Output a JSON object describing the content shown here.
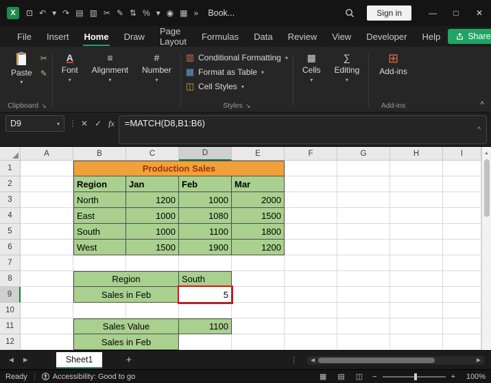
{
  "icons": {
    "chevron_down": "▾",
    "dialog_launcher": "↘",
    "collapse_ribbon": "^",
    "excel_logo": "X",
    "sheet_nav_left": "◀",
    "sheet_nav_right": "▶",
    "hscroll_left": "◀",
    "hscroll_right": "▶",
    "vscroll_up": "▴",
    "add_sheet": "+",
    "cancel": "✕",
    "enter": "✓",
    "insert_function": "fx",
    "formula_dots": "⋮",
    "zoom_out": "−",
    "zoom_in": "+"
  },
  "colors": {
    "accent_green": "#107C41",
    "share_green": "#21A366",
    "table_green": "#A9D08E",
    "title_orange": "#F1A13B",
    "title_text": "#9C3306",
    "annotation_red": "#E01010"
  },
  "titlebar": {
    "workbook_name": "Book...",
    "signin_label": "Sign in",
    "window": {
      "minimize": "—",
      "maximize": "□",
      "close": "✕"
    },
    "quick_access": [
      {
        "name": "save-icon",
        "glyph": "⊡"
      },
      {
        "name": "undo-icon",
        "glyph": "↶"
      },
      {
        "name": "undo-dropdown-icon",
        "glyph": "▾"
      },
      {
        "name": "redo-icon",
        "glyph": "↷"
      },
      {
        "name": "copy-icon",
        "glyph": "▤"
      },
      {
        "name": "paste-small-icon",
        "glyph": "▥"
      },
      {
        "name": "cut-icon",
        "glyph": "✂"
      },
      {
        "name": "format-painter-icon",
        "glyph": "✎"
      },
      {
        "name": "sort-icon",
        "glyph": "⇅"
      },
      {
        "name": "percent-style-icon",
        "glyph": "%"
      },
      {
        "name": "more-commands-icon",
        "glyph": "▾"
      },
      {
        "name": "screenshot-icon",
        "glyph": "◉"
      },
      {
        "name": "table-icon",
        "glyph": "▦"
      },
      {
        "name": "toolbar-overflow-icon",
        "glyph": "»"
      }
    ]
  },
  "menubar": {
    "tabs": [
      "File",
      "Insert",
      "Home",
      "Draw",
      "Page Layout",
      "Formulas",
      "Data",
      "Review",
      "View",
      "Developer",
      "Help"
    ],
    "active_tab": "Home",
    "share_label": "Share"
  },
  "ribbon": {
    "paste_label": "Paste",
    "clipboard_group_label": "Clipboard",
    "collapsed_left": [
      {
        "label": "Font",
        "icon": "font-icon",
        "glyph": "A",
        "cls": "font-a"
      },
      {
        "label": "Alignment",
        "icon": "alignment-icon",
        "glyph": "≡",
        "cls": ""
      },
      {
        "label": "Number",
        "icon": "number-icon",
        "glyph": "#",
        "cls": ""
      }
    ],
    "styles_items": [
      {
        "label": "Conditional Formatting",
        "icon": "conditional-formatting-icon",
        "glyph": "▥",
        "color": "#D9664C"
      },
      {
        "label": "Format as Table",
        "icon": "format-as-table-icon",
        "glyph": "▦",
        "color": "#6B9BD2"
      },
      {
        "label": "Cell Styles",
        "icon": "cell-styles-icon",
        "glyph": "◫",
        "color": "#D8A13E"
      }
    ],
    "styles_group_label": "Styles",
    "collapsed_right": [
      {
        "label": "Cells",
        "icon": "cells-icon",
        "glyph": "▦",
        "cls": ""
      },
      {
        "label": "Editing",
        "icon": "editing-icon",
        "glyph": "∑",
        "cls": ""
      }
    ],
    "addins_label": "Add-ins",
    "addins_group_label": "Add-ins"
  },
  "formula_bar": {
    "name_box": "D9",
    "formula": "=MATCH(D8,B1:B6)"
  },
  "grid": {
    "column_letters": [
      "A",
      "B",
      "C",
      "D",
      "E",
      "F",
      "G",
      "H",
      "I"
    ],
    "row_count": 12,
    "active_cell": "D9",
    "selected_column": "D",
    "selected_row": 9,
    "cells": [
      {
        "ref": "B1",
        "text": "Production Sales",
        "colspan": 4,
        "cls": "c-title tbl tbl-t tbl-l"
      },
      {
        "ref": "B2",
        "text": "Region",
        "cls": "c-green c-bold c-left tbl tbl-l"
      },
      {
        "ref": "C2",
        "text": "Jan",
        "cls": "c-green c-bold c-left tbl"
      },
      {
        "ref": "D2",
        "text": "Feb",
        "cls": "c-green c-bold c-left tbl"
      },
      {
        "ref": "E2",
        "text": "Mar",
        "cls": "c-green c-bold c-left tbl"
      },
      {
        "ref": "B3",
        "text": "North",
        "cls": "c-green c-left tbl tbl-l"
      },
      {
        "ref": "C3",
        "text": "1200",
        "cls": "c-green c-num tbl"
      },
      {
        "ref": "D3",
        "text": "1000",
        "cls": "c-green c-num tbl"
      },
      {
        "ref": "E3",
        "text": "2000",
        "cls": "c-green c-num tbl"
      },
      {
        "ref": "B4",
        "text": "East",
        "cls": "c-green c-left tbl tbl-l"
      },
      {
        "ref": "C4",
        "text": "1000",
        "cls": "c-green c-num tbl"
      },
      {
        "ref": "D4",
        "text": "1080",
        "cls": "c-green c-num tbl"
      },
      {
        "ref": "E4",
        "text": "1500",
        "cls": "c-green c-num tbl"
      },
      {
        "ref": "B5",
        "text": "South",
        "cls": "c-green c-left tbl tbl-l"
      },
      {
        "ref": "C5",
        "text": "1000",
        "cls": "c-green c-num tbl"
      },
      {
        "ref": "D5",
        "text": "1100",
        "cls": "c-green c-num tbl"
      },
      {
        "ref": "E5",
        "text": "1800",
        "cls": "c-green c-num tbl"
      },
      {
        "ref": "B6",
        "text": "West",
        "cls": "c-green c-left tbl tbl-l"
      },
      {
        "ref": "C6",
        "text": "1500",
        "cls": "c-green c-num tbl"
      },
      {
        "ref": "D6",
        "text": "1900",
        "cls": "c-green c-num tbl"
      },
      {
        "ref": "E6",
        "text": "1200",
        "cls": "c-green c-num tbl"
      },
      {
        "ref": "B8",
        "text": "Region",
        "colspan": 2,
        "cls": "c-green c-center tbl tbl-t tbl-l"
      },
      {
        "ref": "D8",
        "text": "South",
        "cls": "c-green c-left tbl tbl-t"
      },
      {
        "ref": "B9",
        "text": "Sales in Feb",
        "colspan": 2,
        "cls": "c-green c-center tbl tbl-l"
      },
      {
        "ref": "D9",
        "text": "5",
        "cls": "c-result c-num"
      },
      {
        "ref": "B11",
        "text": "Sales Value",
        "colspan": 2,
        "cls": "c-green c-center tbl tbl-t tbl-l"
      },
      {
        "ref": "D11",
        "text": "1100",
        "cls": "c-green c-num tbl tbl-t"
      },
      {
        "ref": "B12",
        "text": "Sales in Feb",
        "colspan": 2,
        "cls": "c-green c-center tbl tbl-l"
      }
    ]
  },
  "sheet_bar": {
    "sheet_name": "Sheet1"
  },
  "status_bar": {
    "ready": "Ready",
    "accessibility": "Accessibility: Good to go",
    "zoom": "100%",
    "view_icons": [
      {
        "name": "normal-view-icon",
        "glyph": "▦"
      },
      {
        "name": "page-layout-view-icon",
        "glyph": "▤"
      },
      {
        "name": "page-break-view-icon",
        "glyph": "◫"
      }
    ]
  }
}
